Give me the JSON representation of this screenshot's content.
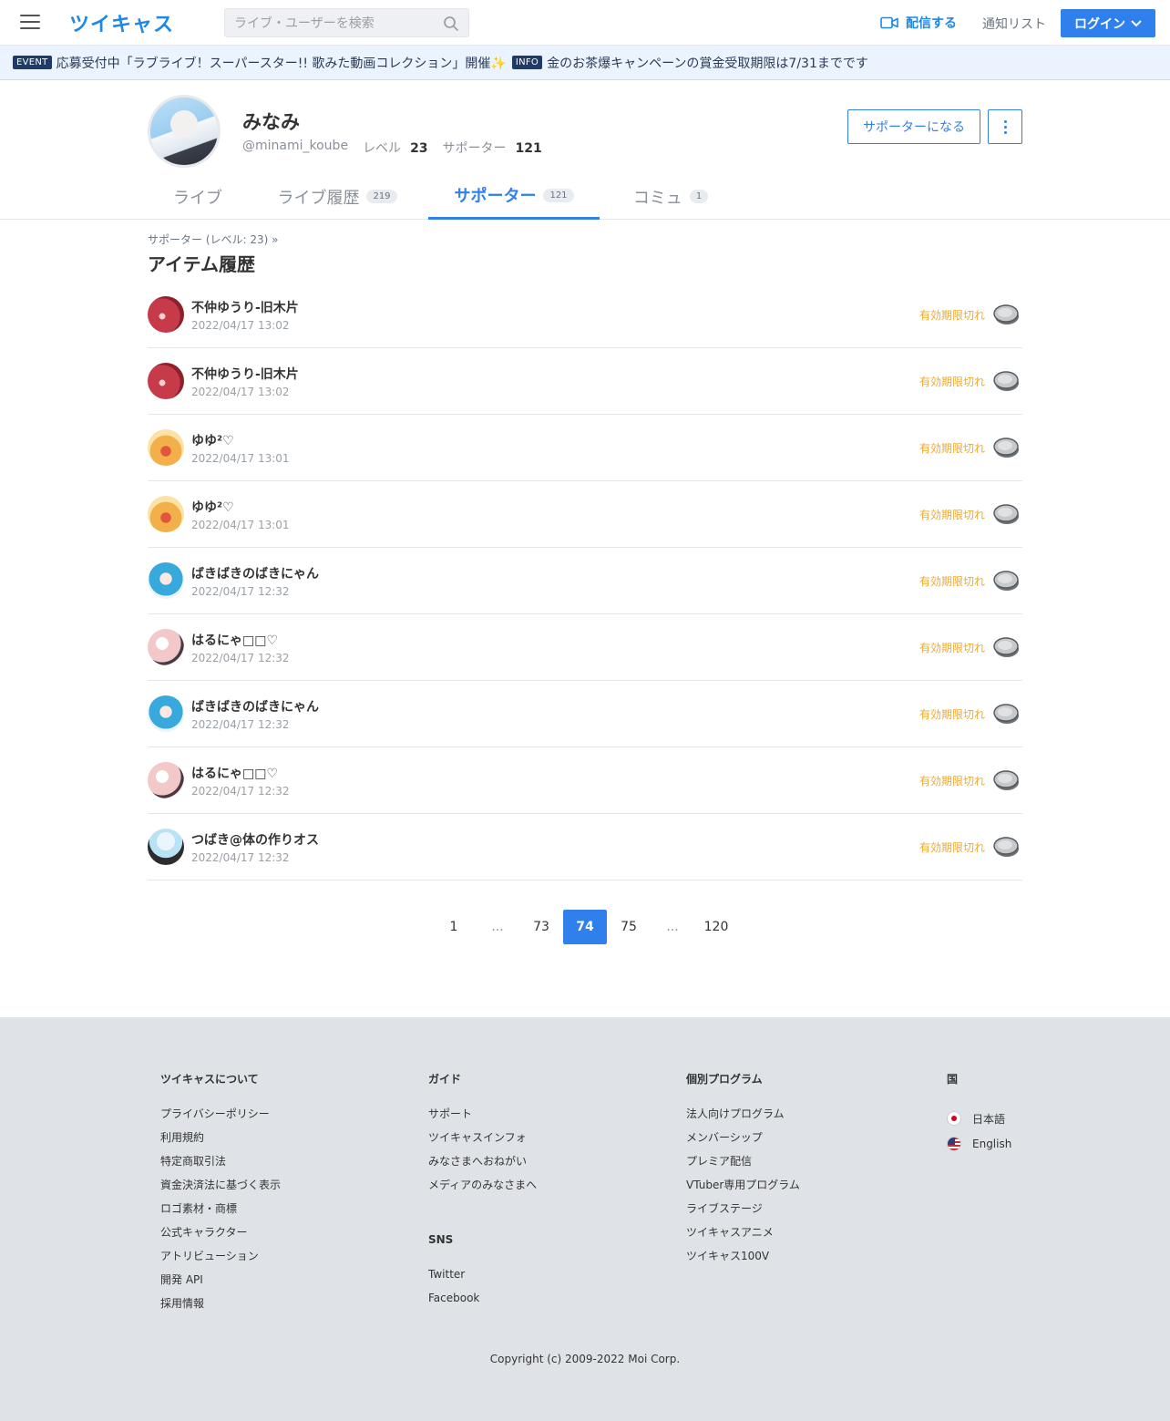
{
  "header": {
    "logo": "ツイキャス",
    "search_placeholder": "ライブ・ユーザーを検索",
    "stream_label": "配信する",
    "notify_label": "通知リスト",
    "login_label": "ログイン"
  },
  "announcements": [
    {
      "tag": "EVENT",
      "text": "応募受付中「ラブライブ！スーパースター!! 歌みた動画コレクション」開催✨"
    },
    {
      "tag": "INFO",
      "text": "金のお茶爆キャンペーンの賞金受取期限は7/31までです"
    }
  ],
  "profile": {
    "name": "みなみ",
    "handle": "@minami_koube",
    "level_label": "レベル",
    "level": "23",
    "supporter_label": "サポーター",
    "supporters": "121",
    "support_button": "サポーターになる"
  },
  "tabs": [
    {
      "label": "ライブ",
      "count": ""
    },
    {
      "label": "ライブ履歴",
      "count": "219"
    },
    {
      "label": "サポーター",
      "count": "121",
      "active": true
    },
    {
      "label": "コミュ",
      "count": "1"
    }
  ],
  "breadcrumb": "サポーター (レベル: 23)  »",
  "page_title": "アイテム履歴",
  "items": [
    {
      "name": "不仲ゆうり-旧木片",
      "date": "2022/04/17 13:02",
      "status": "有効期限切れ"
    },
    {
      "name": "不仲ゆうり-旧木片",
      "date": "2022/04/17 13:02",
      "status": "有効期限切れ"
    },
    {
      "name": "ゆゆ²♡",
      "date": "2022/04/17 13:01",
      "status": "有効期限切れ"
    },
    {
      "name": "ゆゆ²♡",
      "date": "2022/04/17 13:01",
      "status": "有効期限切れ"
    },
    {
      "name": "ばきばきのばきにゃん",
      "date": "2022/04/17 12:32",
      "status": "有効期限切れ"
    },
    {
      "name": "はるにゃ□□♡",
      "date": "2022/04/17 12:32",
      "status": "有効期限切れ"
    },
    {
      "name": "ばきばきのばきにゃん",
      "date": "2022/04/17 12:32",
      "status": "有効期限切れ"
    },
    {
      "name": "はるにゃ□□♡",
      "date": "2022/04/17 12:32",
      "status": "有効期限切れ"
    },
    {
      "name": "つばき@体の作りオス",
      "date": "2022/04/17 12:32",
      "status": "有効期限切れ"
    }
  ],
  "pagination": [
    "1",
    "...",
    "73",
    "74",
    "75",
    "...",
    "120"
  ],
  "pagination_current": "74",
  "footer": {
    "col1": {
      "head": "ツイキャスについて",
      "links": [
        "プライバシーポリシー",
        "利用規約",
        "特定商取引法",
        "資金決済法に基づく表示",
        "ロゴ素材・商標",
        "公式キャラクター",
        "アトリビューション",
        "開発 API",
        "採用情報"
      ]
    },
    "col2": {
      "head": "ガイド",
      "links": [
        "サポート",
        "ツイキャスインフォ",
        "みなさまへおねがい",
        "メディアのみなさまへ"
      ]
    },
    "col2b": {
      "head": "SNS",
      "links": [
        "Twitter",
        "Facebook"
      ]
    },
    "col3": {
      "head": "個別プログラム",
      "links": [
        "法人向けプログラム",
        "メンバーシップ",
        "プレミア配信",
        "VTuber専用プログラム",
        "ライブステージ",
        "ツイキャスアニメ",
        "ツイキャス100V"
      ]
    },
    "col4": {
      "head": "国",
      "langs": [
        "日本語",
        "English"
      ]
    },
    "copyright": "Copyright (c) 2009-2022 Moi Corp."
  },
  "colors": {
    "accent": "#2f7fed",
    "expired": "#f0a830",
    "footer_bg": "#dfe3e8"
  }
}
